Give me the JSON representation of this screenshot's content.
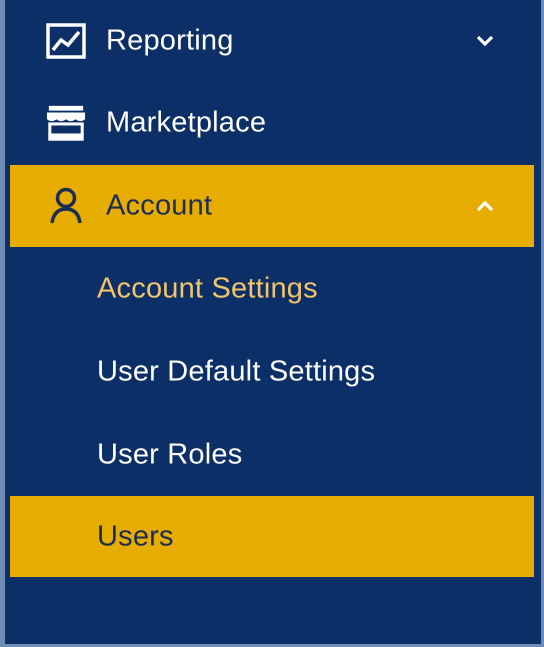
{
  "sidebar": {
    "items": [
      {
        "label": "Reporting",
        "icon": "chart-line-icon",
        "chevron": "chevron-down-icon",
        "expanded": false
      },
      {
        "label": "Marketplace",
        "icon": "storefront-icon"
      },
      {
        "label": "Account",
        "icon": "user-icon",
        "chevron": "chevron-up-icon",
        "expanded": true,
        "active": true
      }
    ],
    "account_submenu": [
      {
        "label": "Account Settings",
        "state": "current"
      },
      {
        "label": "User Default Settings",
        "state": "normal"
      },
      {
        "label": "User Roles",
        "state": "normal"
      },
      {
        "label": "Users",
        "state": "selected"
      }
    ]
  },
  "colors": {
    "sidebar_bg": "#0b2f66",
    "active_bg": "#e6ac00",
    "text": "#ffffff",
    "active_text": "#1a2d55",
    "current_link_text": "#f2c46b",
    "frame_border": "#6f8db6"
  }
}
